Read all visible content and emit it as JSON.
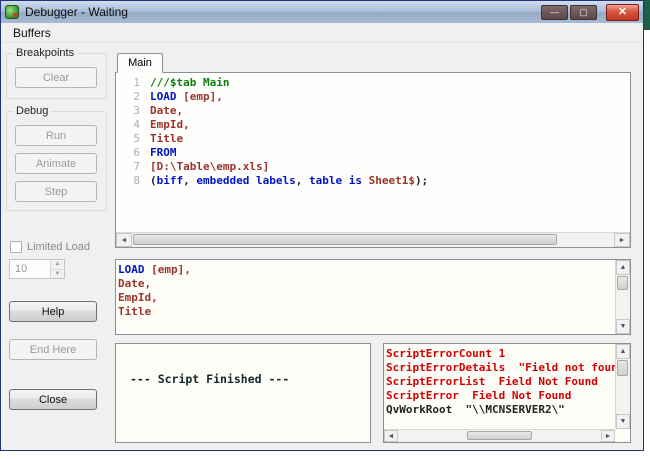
{
  "titlebar": {
    "title": "Debugger - Waiting",
    "minimize": "—",
    "maximize": "▢",
    "close": "✕"
  },
  "menu": {
    "buffers": "Buffers"
  },
  "icons": {
    "left": "◄",
    "right": "►",
    "up": "▲",
    "down": "▼"
  },
  "sidebar": {
    "breakpoints_label": "Breakpoints",
    "clear_label": "Clear",
    "debug_label": "Debug",
    "run_label": "Run",
    "animate_label": "Animate",
    "step_label": "Step",
    "limited_load_label": "Limited Load",
    "limit_value": "10",
    "help_label": "Help",
    "end_here_label": "End Here",
    "close_label": "Close"
  },
  "editor": {
    "tab_label": "Main",
    "lines": [
      {
        "n": "1",
        "parts": [
          [
            "///$tab Main",
            "comment"
          ]
        ]
      },
      {
        "n": "2",
        "parts": [
          [
            "LOAD",
            "kw"
          ],
          [
            " ",
            "plain"
          ],
          [
            "[emp],",
            "field"
          ]
        ]
      },
      {
        "n": "3",
        "parts": [
          [
            "Date,",
            "field"
          ]
        ]
      },
      {
        "n": "4",
        "parts": [
          [
            "EmpId,",
            "field"
          ]
        ]
      },
      {
        "n": "5",
        "parts": [
          [
            "Title",
            "field"
          ]
        ]
      },
      {
        "n": "6",
        "parts": [
          [
            "FROM",
            "kw"
          ]
        ]
      },
      {
        "n": "7",
        "parts": [
          [
            "[D:\\Table\\emp.xls]",
            "field"
          ]
        ]
      },
      {
        "n": "8",
        "parts": [
          [
            "(",
            "plain"
          ],
          [
            "biff",
            "kw"
          ],
          [
            ", ",
            "plain"
          ],
          [
            "embedded labels",
            "kw"
          ],
          [
            ", ",
            "plain"
          ],
          [
            "table is",
            "kw"
          ],
          [
            " ",
            "plain"
          ],
          [
            "Sheet1$",
            "field"
          ],
          [
            ");",
            "plain"
          ]
        ]
      }
    ]
  },
  "progress": {
    "lines": [
      {
        "parts": [
          [
            "LOAD",
            "kw"
          ],
          [
            " ",
            "plain"
          ],
          [
            "[emp],",
            "field"
          ]
        ]
      },
      {
        "parts": [
          [
            "Date,",
            "field"
          ]
        ]
      },
      {
        "parts": [
          [
            "EmpId,",
            "field"
          ]
        ]
      },
      {
        "parts": [
          [
            "Title",
            "field"
          ]
        ]
      }
    ]
  },
  "status": {
    "message": "--- Script Finished ---"
  },
  "variables": {
    "lines": [
      {
        "parts": [
          [
            "ScriptErrorCount 1",
            "err"
          ]
        ]
      },
      {
        "parts": [
          [
            "ScriptErrorDetails  \"Field not found",
            "err"
          ]
        ]
      },
      {
        "parts": [
          [
            "ScriptErrorList  Field Not Found",
            "err"
          ]
        ]
      },
      {
        "parts": [
          [
            "ScriptError  Field Not Found",
            "err"
          ]
        ]
      },
      {
        "parts": [
          [
            "QvWorkRoot  \"\\\\MCNSERVER2\\\"",
            "var"
          ]
        ]
      }
    ]
  },
  "colors": {
    "accent_title": "#a9bcd6",
    "error_red": "#d40000",
    "keyword_blue": "#0014c8",
    "field_red": "#9c332b",
    "comment_green": "#0f7d0f"
  }
}
